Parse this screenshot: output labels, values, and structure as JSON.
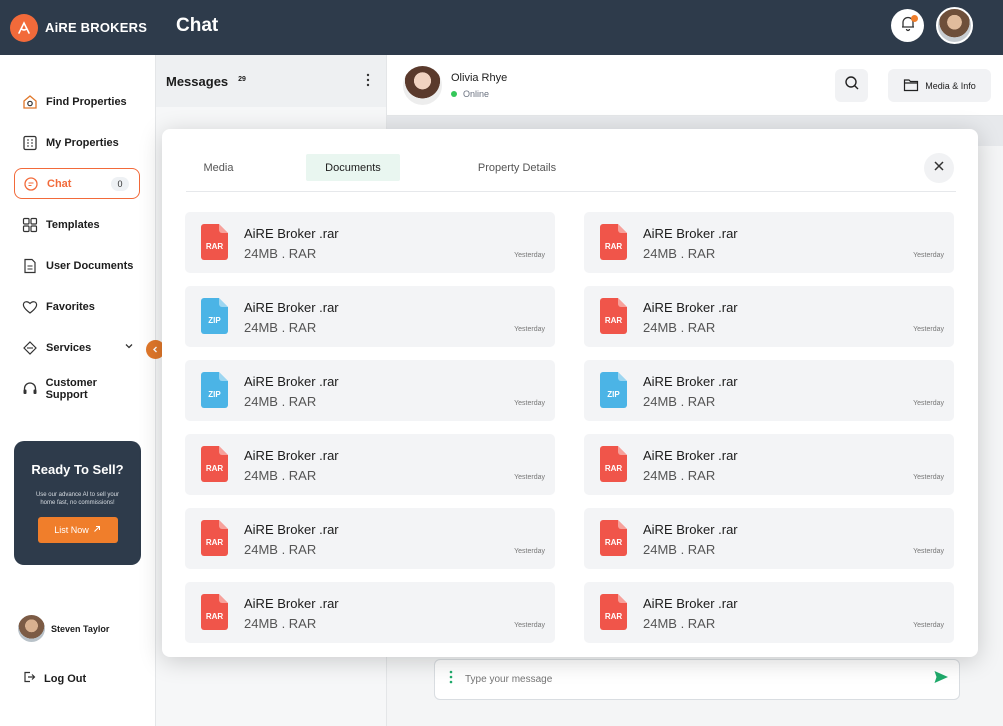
{
  "brand": {
    "name": "AiRE BROKERS"
  },
  "topbar": {
    "title": "Chat"
  },
  "sidebar": {
    "items": [
      {
        "label": "Find Properties",
        "icon": "home-search-icon",
        "active": false
      },
      {
        "label": "My Properties",
        "icon": "building-icon",
        "active": false
      },
      {
        "label": "Chat",
        "icon": "chat-icon",
        "active": true,
        "count": "0"
      },
      {
        "label": "Templates",
        "icon": "templates-icon",
        "active": false
      },
      {
        "label": "User Documents",
        "icon": "document-icon",
        "active": false
      },
      {
        "label": "Favorites",
        "icon": "heart-icon",
        "active": false
      },
      {
        "label": "Services",
        "icon": "services-icon",
        "active": false
      },
      {
        "label": "Customer Support",
        "icon": "headset-icon",
        "active": false
      }
    ],
    "promo": {
      "title": "Ready To Sell?",
      "text": "Use our advance AI to sell your home fast, no commissions!",
      "button": "List Now"
    },
    "user_name": "Steven Taylor",
    "logout": "Log Out"
  },
  "messages": {
    "title": "Messages",
    "count": "29"
  },
  "conversation": {
    "name": "Olivia Rhye",
    "status": "Online",
    "media_button": "Media & Info"
  },
  "composer": {
    "placeholder": "Type your message"
  },
  "modal": {
    "tabs": [
      "Media",
      "Documents",
      "Property Details"
    ],
    "active_tab": "Documents",
    "documents": [
      {
        "name": "AiRE Broker .rar",
        "meta": "24MB .  RAR",
        "time": "Yesterday",
        "type": "RAR"
      },
      {
        "name": "AiRE Broker .rar",
        "meta": "24MB .  RAR",
        "time": "Yesterday",
        "type": "RAR"
      },
      {
        "name": "AiRE Broker .rar",
        "meta": "24MB .  RAR",
        "time": "Yesterday",
        "type": "ZIP"
      },
      {
        "name": "AiRE Broker .rar",
        "meta": "24MB .  RAR",
        "time": "Yesterday",
        "type": "RAR"
      },
      {
        "name": "AiRE Broker .rar",
        "meta": "24MB .  RAR",
        "time": "Yesterday",
        "type": "ZIP"
      },
      {
        "name": "AiRE Broker .rar",
        "meta": "24MB .  RAR",
        "time": "Yesterday",
        "type": "ZIP"
      },
      {
        "name": "AiRE Broker .rar",
        "meta": "24MB .  RAR",
        "time": "Yesterday",
        "type": "RAR"
      },
      {
        "name": "AiRE Broker .rar",
        "meta": "24MB .  RAR",
        "time": "Yesterday",
        "type": "RAR"
      },
      {
        "name": "AiRE Broker .rar",
        "meta": "24MB .  RAR",
        "time": "Yesterday",
        "type": "RAR"
      },
      {
        "name": "AiRE Broker .rar",
        "meta": "24MB .  RAR",
        "time": "Yesterday",
        "type": "RAR"
      },
      {
        "name": "AiRE Broker .rar",
        "meta": "24MB .  RAR",
        "time": "Yesterday",
        "type": "RAR"
      },
      {
        "name": "AiRE Broker .rar",
        "meta": "24MB .  RAR",
        "time": "Yesterday",
        "type": "RAR"
      }
    ]
  },
  "colors": {
    "navy": "#2e3b4b",
    "accent": "#f26a3a",
    "rar": "#f0554a",
    "zip": "#4bb4e6",
    "online": "#34c759",
    "send": "#1faa6b"
  }
}
